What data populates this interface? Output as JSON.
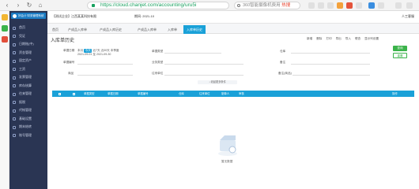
{
  "browser": {
    "url": "https://cloud.chanjet.com/accounting/uru5i",
    "search_text": "360智能摄像机费用",
    "search_hot": "热搜"
  },
  "sidebar": {
    "logo_text": "好会计 财务管理系统",
    "items": [
      "首页",
      "凭证",
      "日期账(中)",
      "资金管理",
      "固定资产",
      "工资",
      "发票管理",
      "库存核算",
      "往来管理",
      "报税",
      "代帐管理",
      "基础设置",
      "期末结转",
      "账号管理"
    ]
  },
  "topbar": {
    "company": "【测试企业】江西某某科技有限",
    "period_label": "期间:",
    "period_value": "2021-10",
    "customer_service": "人工客服"
  },
  "tabs": [
    "首页",
    "产成品入库单",
    "产成品入库历史",
    "产成品入库单",
    "入库单",
    "入库单历史"
  ],
  "page": {
    "title": "入库单历史",
    "toolbar": [
      "新增",
      "删除",
      "打印",
      "导出",
      "导入",
      "联查",
      "显示列设置"
    ]
  },
  "filter": {
    "date_label": "单据日期",
    "date_chips": [
      "本月",
      "今天",
      "近7天",
      "近30天",
      "本季度"
    ],
    "date_range": "2021-09-01 至 2021-09-30",
    "doc_no_label": "单据编号",
    "product_label": "商品",
    "doc_type_label": "单据类型",
    "business_type_label": "业务类型",
    "supplier_label": "往来单位",
    "warehouse_label": "仓库",
    "remark_label": "备注",
    "remark_product_label": "备注(商品)",
    "expand_label": "↓ 收起更多条件",
    "search_btn": "查询",
    "reset_btn": "重置"
  },
  "table": {
    "headers": [
      "单据类型",
      "单据日期",
      "单据编号",
      "仓库",
      "往来单位",
      "制单人",
      "审核",
      "操作"
    ]
  },
  "empty": {
    "text": "暂无数据"
  }
}
